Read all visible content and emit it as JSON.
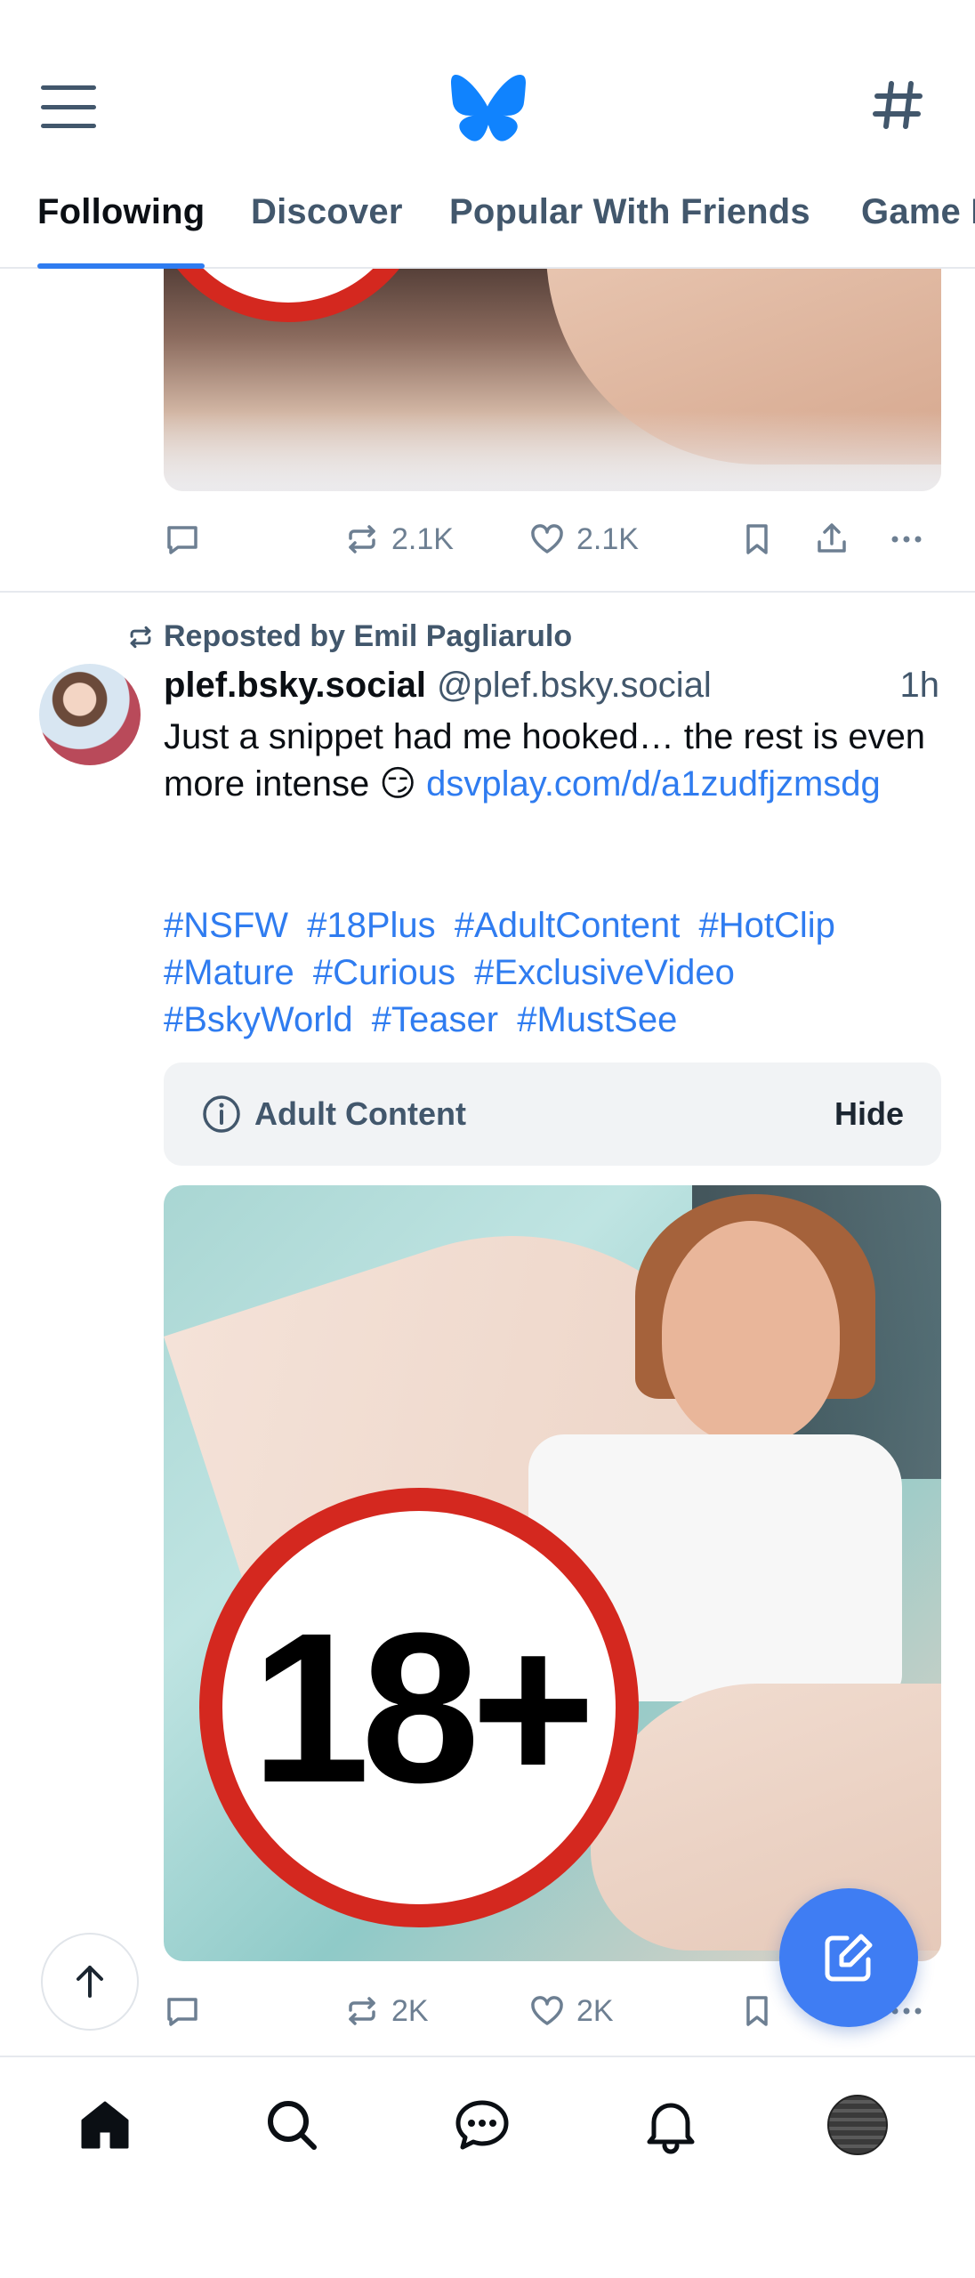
{
  "header": {
    "tabs": [
      {
        "label": "Following",
        "active": true
      },
      {
        "label": "Discover",
        "active": false
      },
      {
        "label": "Popular With Friends",
        "active": false
      },
      {
        "label": "Game I",
        "active": false
      }
    ],
    "icons": {
      "menu": "menu-icon",
      "logo": "butterfly-logo",
      "feeds": "hashtag-icon"
    },
    "accent_color": "#2f7cf0"
  },
  "previous_post": {
    "actions": {
      "reposts": "2.1K",
      "likes": "2.1K"
    }
  },
  "post": {
    "repost_label": "Reposted by Emil Pagliarulo",
    "author_name": "plef.bsky.social",
    "author_handle": "@plef.bsky.social",
    "time": "1h",
    "text": "Just a snippet had me hooked… the rest is even more intense 😏 ",
    "link": "dsvplay.com/d/a1zudfjzmsdg",
    "tags": [
      "#NSFW",
      "#18Plus",
      "#AdultContent",
      "#HotClip",
      "#Mature",
      "#Curious",
      "#ExclusiveVideo",
      "#BskyWorld",
      "#Teaser",
      "#MustSee"
    ],
    "label": {
      "text": "Adult Content",
      "action": "Hide"
    },
    "media_badge": "18+",
    "actions": {
      "reposts": "2K",
      "likes": "2K"
    }
  },
  "bottom_nav": {
    "items": [
      "home-icon",
      "search-icon",
      "chat-icon",
      "bell-icon",
      "profile-avatar"
    ]
  }
}
